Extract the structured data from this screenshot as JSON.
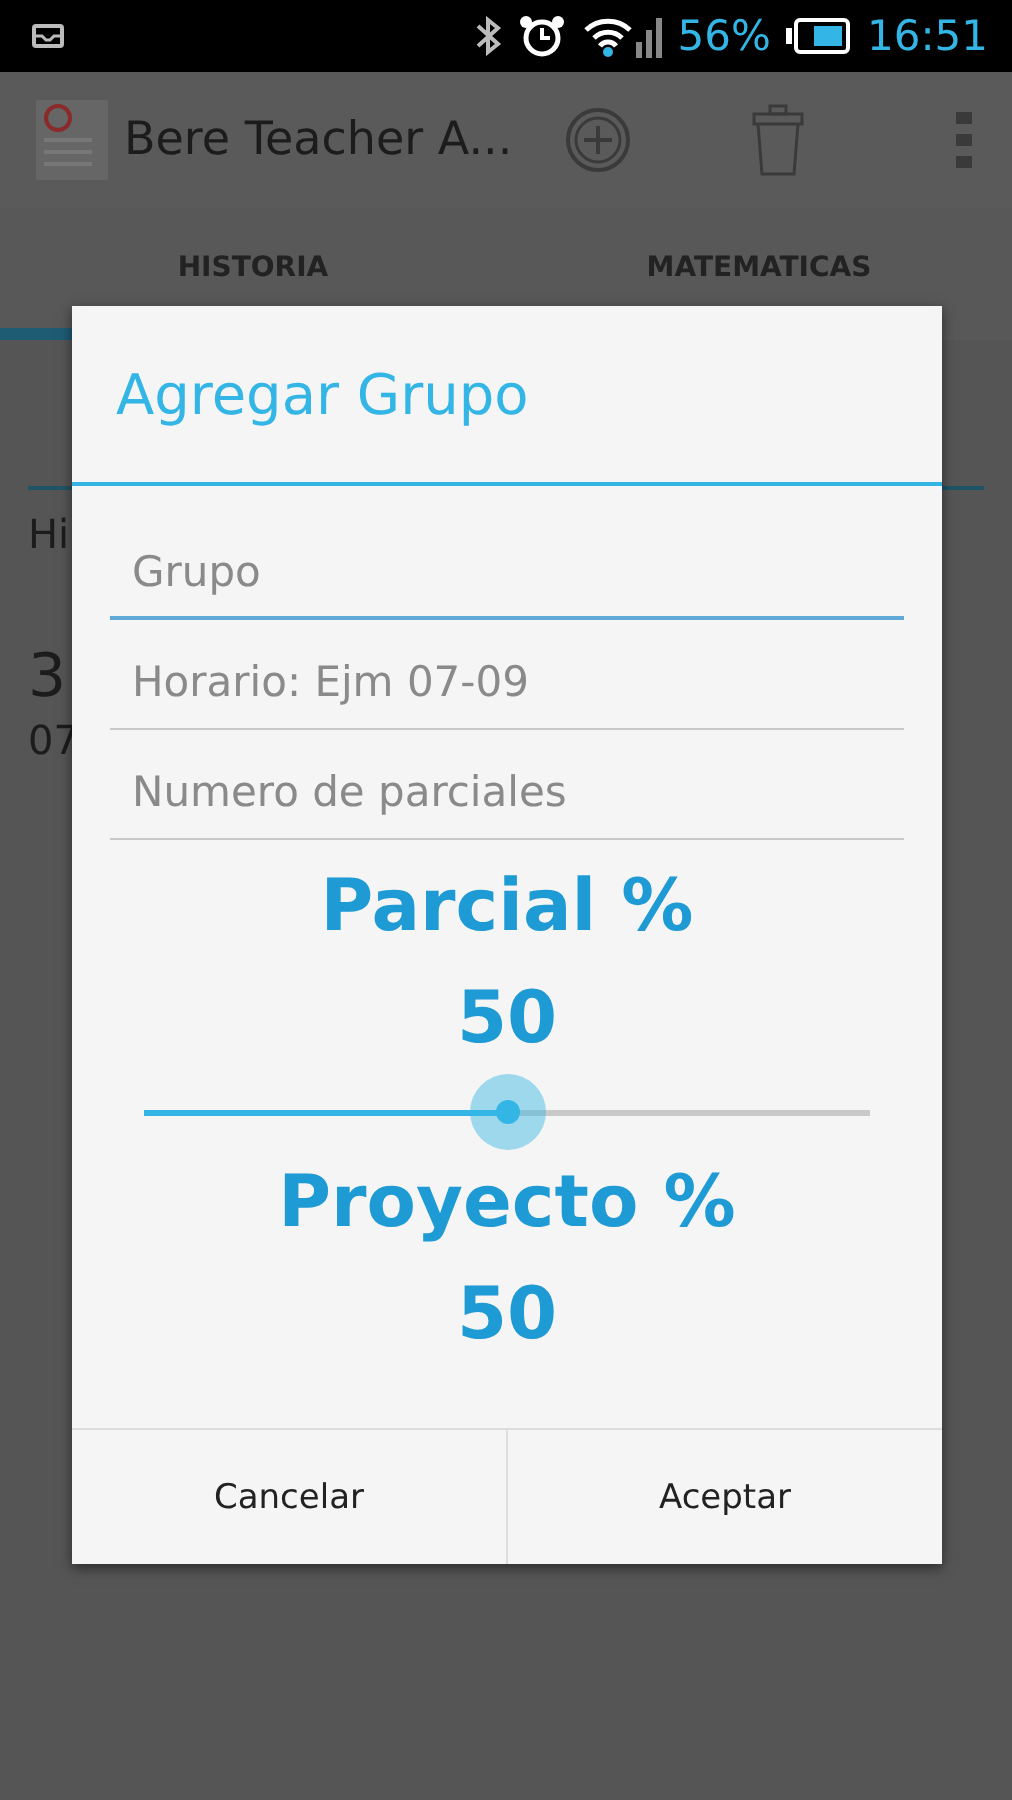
{
  "status_bar": {
    "battery": "56%",
    "time": "16:51"
  },
  "action_bar": {
    "title": "Bere Teacher A..."
  },
  "tabs": [
    {
      "label": "HISTORIA",
      "selected": true
    },
    {
      "label": "MATEMATICAS",
      "selected": false
    }
  ],
  "background": {
    "header": "Hi",
    "number": "3",
    "detail": "07"
  },
  "dialog": {
    "title": "Agregar Grupo",
    "fields": [
      {
        "placeholder": "Grupo",
        "focused": true
      },
      {
        "placeholder": "Horario: Ejm 07-09",
        "focused": false
      },
      {
        "placeholder": "Numero de parciales",
        "focused": false
      }
    ],
    "parcial_label": "Parcial %",
    "parcial_value": "50",
    "slider": {
      "level": 0.5
    },
    "proyecto_label": "Proyecto %",
    "proyecto_value": "50",
    "buttons": [
      "Cancelar",
      "Aceptar"
    ]
  }
}
